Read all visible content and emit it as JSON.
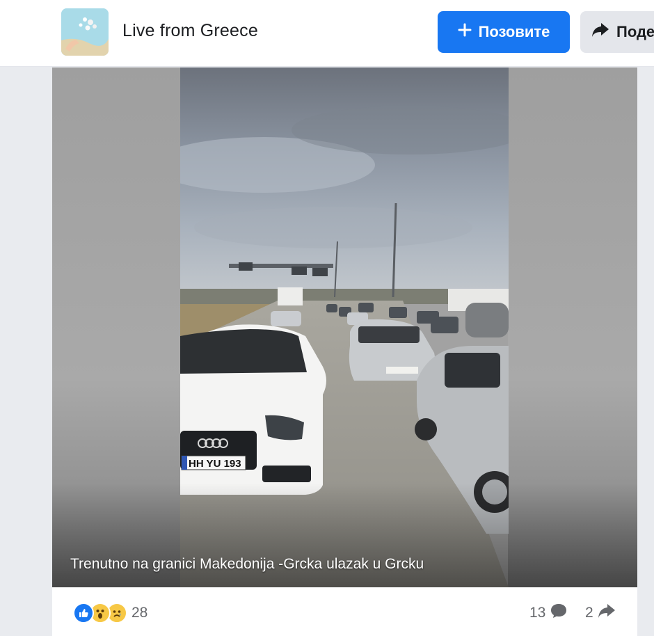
{
  "header": {
    "page_name": "Live from Greece",
    "invite_label": "Позовите",
    "share_label": "Поде"
  },
  "video": {
    "caption": "Trenutno na granici Makedonija -Grcka ulazak u Grcku",
    "plate_text": "HH YU 193"
  },
  "footer": {
    "reaction_icons": [
      "like-icon",
      "wow-icon",
      "sad-icon"
    ],
    "reaction_count": "28",
    "comment_count": "13",
    "share_count": "2"
  },
  "colors": {
    "accent": "#1877f2",
    "text_primary": "#1c1e21",
    "text_secondary": "#65676b"
  }
}
